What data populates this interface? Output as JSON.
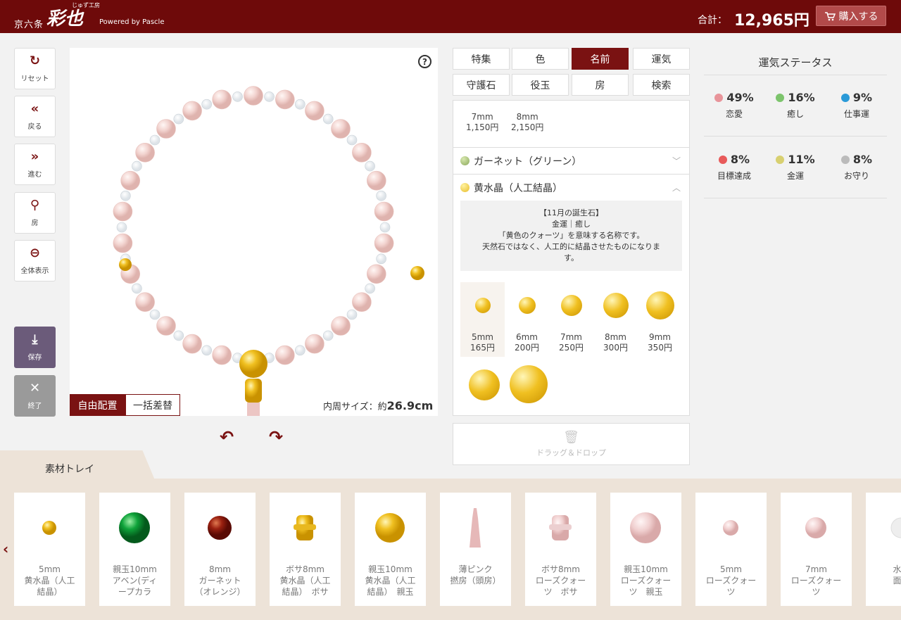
{
  "header": {
    "logo_prefix": "京六条",
    "logo_main": "彩也",
    "logo_sub": "じゅず工房",
    "powered": "Powered by Pascle",
    "total_label": "合計：",
    "total_value": "12,965円",
    "buy_label": "購入する"
  },
  "tools": {
    "reset": "リセット",
    "back": "戻る",
    "forward": "進む",
    "tassel": "房",
    "fit": "全体表示",
    "save": "保存",
    "end": "終了"
  },
  "canvas": {
    "help": "?",
    "mode_free": "自由配置",
    "mode_bulk": "一括差替",
    "size_prefix": "内周サイズ：約",
    "size_value": "26.9cm"
  },
  "tabs": [
    "特集",
    "色",
    "名前",
    "運気",
    "守護石",
    "役玉",
    "房",
    "検索"
  ],
  "active_tab": "名前",
  "panel": {
    "size_options": [
      {
        "size": "7mm",
        "price": "1,150円"
      },
      {
        "size": "8mm",
        "price": "2,150円"
      }
    ],
    "accordions": [
      {
        "label": "ガーネット（グリーン）",
        "color": "#8aa85a"
      },
      {
        "label": "黄水晶（人工結晶）",
        "color": "#e8bd2a"
      }
    ],
    "description": [
      "【11月の誕生石】",
      "金運｜癒し",
      "「黄色のクォーツ」を意味する名称です。",
      "天然石ではなく、人工的に結晶させたものになりま",
      "す。"
    ],
    "bead_options": [
      {
        "size": "5mm",
        "price": "165円"
      },
      {
        "size": "6mm",
        "price": "200円"
      },
      {
        "size": "7mm",
        "price": "250円"
      },
      {
        "size": "8mm",
        "price": "300円"
      },
      {
        "size": "9mm",
        "price": "350円"
      }
    ],
    "trash_label": "ドラッグ＆ドロップ"
  },
  "status": {
    "title": "運気ステータス",
    "items": [
      {
        "pct": "49%",
        "name": "恋愛",
        "color": "#e8949a"
      },
      {
        "pct": "16%",
        "name": "癒し",
        "color": "#7cc46c"
      },
      {
        "pct": "9%",
        "name": "仕事運",
        "color": "#2a9ad8"
      },
      {
        "pct": "8%",
        "name": "目標達成",
        "color": "#e85a5a"
      },
      {
        "pct": "11%",
        "name": "金運",
        "color": "#d8d070"
      },
      {
        "pct": "8%",
        "name": "お守り",
        "color": "#bbbbbb"
      }
    ]
  },
  "tray": {
    "title": "素材トレイ",
    "items": [
      [
        "5mm",
        "黄水晶（人工",
        "結晶）"
      ],
      [
        "親玉10mm",
        "アベン(ディ",
        "ープカラ"
      ],
      [
        "8mm",
        "ガーネット",
        "（オレンジ）"
      ],
      [
        "ボサ8mm",
        "黄水晶（人工",
        "結晶）　ボサ"
      ],
      [
        "親玉10mm",
        "黄水晶（人工",
        "結晶）　親玉"
      ],
      [
        "薄ピンク",
        "撚房（頭房）"
      ],
      [
        "ボサ8mm",
        "ローズクォー",
        "ツ　ボサ"
      ],
      [
        "親玉10mm",
        "ローズクォー",
        "ツ　親玉"
      ],
      [
        "5mm",
        "ローズクォー",
        "ツ"
      ],
      [
        "7mm",
        "ローズクォー",
        "ツ"
      ],
      [
        "水晶",
        "面切"
      ]
    ]
  }
}
